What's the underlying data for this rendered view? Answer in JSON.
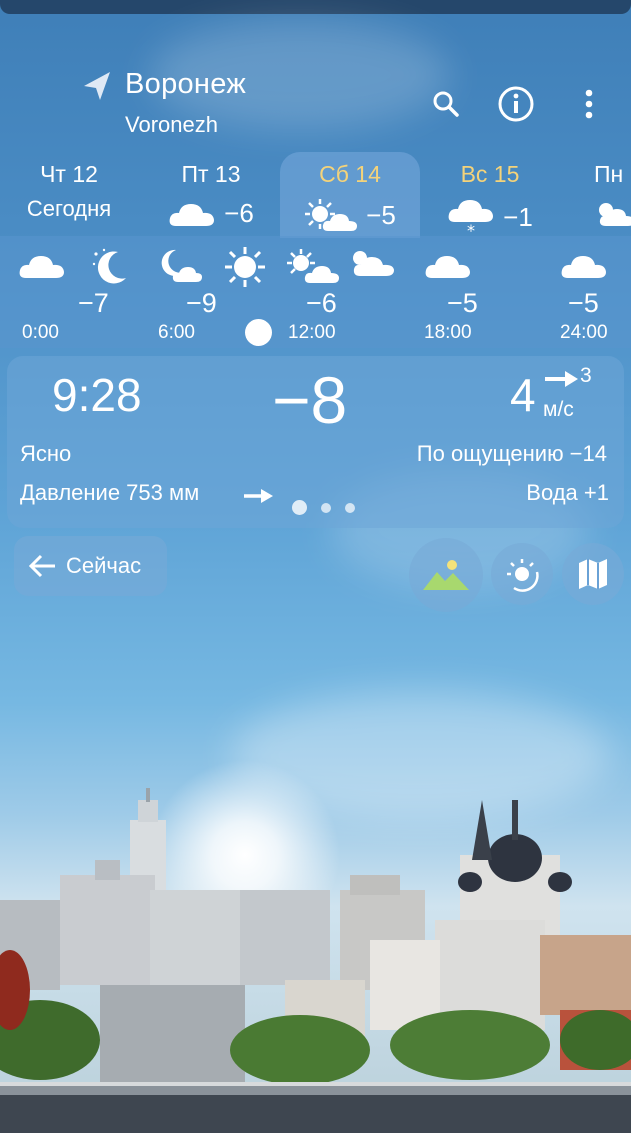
{
  "header": {
    "city": "Воронеж",
    "city_en": "Voronezh",
    "icons": [
      "location-arrow-icon",
      "search-icon",
      "info-icon",
      "more-vert-icon"
    ]
  },
  "days": [
    {
      "name": "Чт 12",
      "sub": "Сегодня",
      "temp": "",
      "icon": "none",
      "active": false,
      "weekend": false
    },
    {
      "name": "Пт 13",
      "sub": "",
      "temp": "−6",
      "icon": "cloud-icon",
      "active": false,
      "weekend": false
    },
    {
      "name": "Сб 14",
      "sub": "",
      "temp": "−5",
      "icon": "sun-cloud-icon",
      "active": true,
      "weekend": true
    },
    {
      "name": "Вс 15",
      "sub": "",
      "temp": "−1",
      "icon": "snow-cloud-icon",
      "active": false,
      "weekend": true
    },
    {
      "name": "Пн",
      "sub": "",
      "temp": "",
      "icon": "sun-cloud-icon",
      "active": false,
      "weekend": false
    }
  ],
  "hourly": {
    "temps": [
      "−7",
      "−9",
      "−6",
      "−5",
      "−5"
    ],
    "times": [
      "0:00",
      "6:00",
      "12:00",
      "18:00",
      "24:00"
    ],
    "icons": [
      "cloud-icon",
      "moon-stars-icon",
      "moon-cloud-icon",
      "sun-icon",
      "sun-cloud-icon",
      "cloud-sun-icon",
      "cloud-icon",
      "cloud-icon"
    ]
  },
  "current": {
    "time": "9:28",
    "temp": "−8",
    "wind": "4",
    "wind_unit": "м/с",
    "gust": "3",
    "condition": "Ясно",
    "feels": "По ощущению −14",
    "pressure": "Давление 753 мм",
    "water": "Вода +1"
  },
  "buttons": {
    "now": "Сейчас"
  },
  "colors": {
    "weekend": "#f4d37a",
    "panel": "rgba(110,165,215,0.55)"
  }
}
